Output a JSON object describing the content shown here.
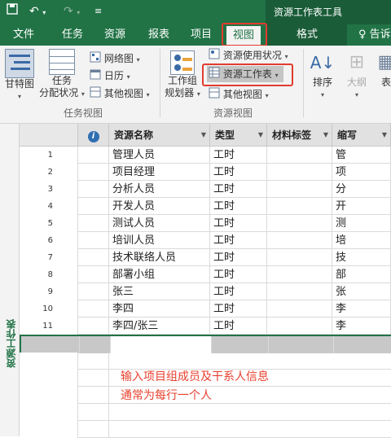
{
  "title_bar": {
    "context_group": "资源工作表工具",
    "undo_icon": "undo-icon",
    "redo_icon": "redo-icon",
    "customize_icon": "customize-qat-icon"
  },
  "tabs": [
    "文件",
    "任务",
    "资源",
    "报表",
    "项目",
    "视图",
    "格式",
    "告诉"
  ],
  "ribbon": {
    "gantt": "甘特图",
    "task_board_l1": "任务",
    "task_board_l2": "分配状况",
    "network": "网络图",
    "calendar": "日历",
    "other_views_1": "其他视图",
    "group_task_views": "任务视图",
    "team_planner_l1": "工作组",
    "team_planner_l2": "规划器",
    "resource_usage": "资源使用状况",
    "resource_sheet": "资源工作表",
    "other_views_2": "其他视图",
    "group_resource_views": "资源视图",
    "sort": "排序",
    "outline": "大纲",
    "tables": "表"
  },
  "sheet": {
    "side_label": "资源工作表",
    "headers": {
      "info": "i",
      "name": "资源名称",
      "type": "类型",
      "material": "材料标签",
      "initials": "缩写"
    },
    "rows": [
      {
        "id": "1",
        "name": "管理人员",
        "type": "工时",
        "initials": "管"
      },
      {
        "id": "2",
        "name": "项目经理",
        "type": "工时",
        "initials": "项"
      },
      {
        "id": "3",
        "name": "分析人员",
        "type": "工时",
        "initials": "分"
      },
      {
        "id": "4",
        "name": "开发人员",
        "type": "工时",
        "initials": "开"
      },
      {
        "id": "5",
        "name": "测试人员",
        "type": "工时",
        "initials": "测"
      },
      {
        "id": "6",
        "name": "培训人员",
        "type": "工时",
        "initials": "培"
      },
      {
        "id": "7",
        "name": "技术联络人员",
        "type": "工时",
        "initials": "技"
      },
      {
        "id": "8",
        "name": "部署小组",
        "type": "工时",
        "initials": "部"
      },
      {
        "id": "9",
        "name": "张三",
        "type": "工时",
        "initials": "张"
      },
      {
        "id": "10",
        "name": "李四",
        "type": "工时",
        "initials": "李"
      },
      {
        "id": "11",
        "name": "李四/张三",
        "type": "工时",
        "initials": "李"
      }
    ],
    "note_line1": "输入项目组成员及干系人信息",
    "note_line2": "通常为每行一个人"
  },
  "colors": {
    "accent": "#217346",
    "highlight": "#e23b2e"
  }
}
